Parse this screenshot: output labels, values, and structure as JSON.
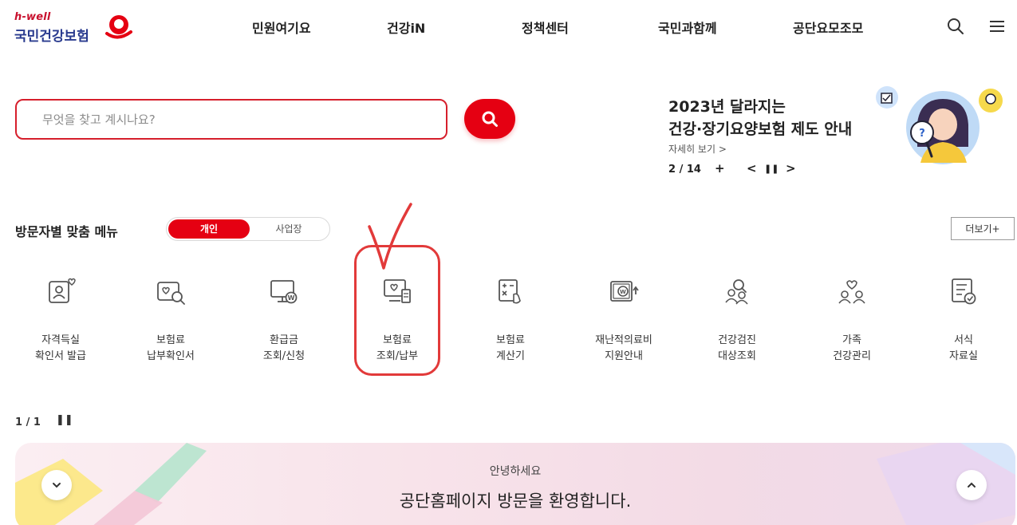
{
  "header": {
    "logo": {
      "tagline": "h-well",
      "name": "국민건강보험"
    },
    "nav": [
      "민원여기요",
      "건강iN",
      "정책센터",
      "국민과함께",
      "공단요모조모"
    ],
    "icons": [
      "search-icon",
      "hamburger-menu-icon"
    ]
  },
  "search": {
    "placeholder": "무엇을 찾고 계시나요?",
    "value": ""
  },
  "banner": {
    "title_line1": "2023년 달라지는",
    "title_line2": "건강·장기요양보험 제도 안내",
    "more": "자세히 보기 >",
    "pager": "2 / 14",
    "controls": {
      "plus": "+",
      "prev": "<",
      "pause": "❚❚",
      "next": ">"
    }
  },
  "custom_menu": {
    "title": "방문자별 맞춤 메뉴",
    "toggle": {
      "personal": "개인",
      "business": "사업장",
      "selected": "개인"
    },
    "more": "더보기+",
    "items": [
      {
        "label": "자격득실\n확인서 발급",
        "icon": "id-card-icon"
      },
      {
        "label": "보험료\n납부확인서",
        "icon": "certificate-search-icon"
      },
      {
        "label": "환급금\n조회/신청",
        "icon": "refund-monitor-icon"
      },
      {
        "label": "보험료\n조회/납부",
        "icon": "premium-pay-icon"
      },
      {
        "label": "보험료\n계산기",
        "icon": "calculator-icon"
      },
      {
        "label": "재난적의료비\n지원안내",
        "icon": "medical-support-icon"
      },
      {
        "label": "건강검진\n대상조회",
        "icon": "people-search-icon"
      },
      {
        "label": "가족\n건강관리",
        "icon": "family-health-icon"
      },
      {
        "label": "서식\n자료실",
        "icon": "document-form-icon"
      }
    ],
    "pager": "1 / 1",
    "pause": "❚❚"
  },
  "welcome": {
    "subtitle": "안녕하세요",
    "title": "공단홈페이지 방문을 환영합니다."
  },
  "colors": {
    "accent": "#e50012",
    "brand_navy": "#2a3b8f",
    "annotation": "#e23a3a"
  }
}
